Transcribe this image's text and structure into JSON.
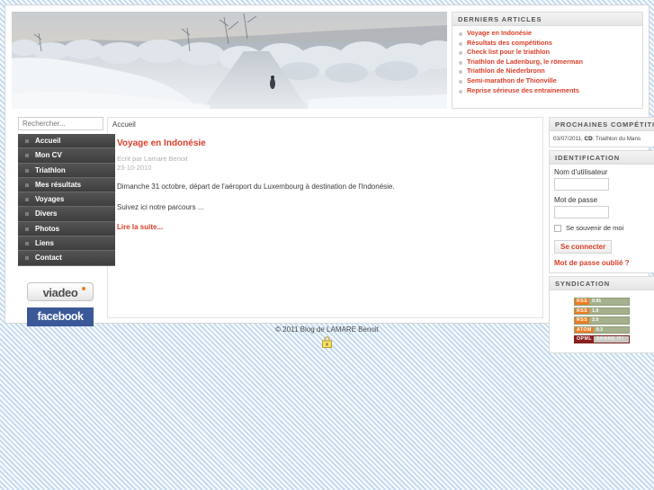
{
  "header": {
    "banner_alt": "snowy-winter-landscape-path"
  },
  "latest_articles": {
    "title": "DERNIERS ARTICLES",
    "items": [
      "Voyage en Indonésie",
      "Résultats des compétitions",
      "Check list pour le triathlon",
      "Triathlon de Ladenburg, le römerman",
      "Triathlon de Niederbronn",
      "Semi-marathon de Thionville",
      "Reprise sérieuse des entrainements"
    ]
  },
  "search": {
    "placeholder": "Rechercher..."
  },
  "breadcrumb": {
    "current": "Accueil"
  },
  "nav": {
    "items": [
      "Accueil",
      "Mon CV",
      "Triathlon",
      "Mes résultats",
      "Voyages",
      "Divers",
      "Photos",
      "Liens",
      "Contact"
    ]
  },
  "social": {
    "viadeo": "viadeo",
    "facebook": "facebook"
  },
  "article": {
    "title": "Voyage en Indonésie",
    "author_line": "Ecrit par Lamare Benoit",
    "date": "23-10-2010",
    "paragraph1": "Dimanche 31 octobre, départ de l'aéroport du Luxembourg à destination de l'Indonésie.",
    "paragraph2": "Suivez ici notre parcours ...",
    "read_more": "Lire la suite..."
  },
  "competitions": {
    "title": "PROCHAINES COMPÉTITIONS",
    "date": "03/07/2011, ",
    "category": "CD",
    "event": ": Triathlon du Mans"
  },
  "identification": {
    "title": "IDENTIFICATION",
    "username_label": "Nom d'utilisateur",
    "username_value": "",
    "password_label": "Mot de passe",
    "password_value": "",
    "remember_label": "Se souvenir de moi",
    "login_button": "Se connecter",
    "forgot_password": "Mot de passe oublié ?"
  },
  "syndication": {
    "title": "SYNDICATION",
    "feeds": [
      {
        "kind": "RSS",
        "version": "0.91"
      },
      {
        "kind": "RSS",
        "version": "1.0"
      },
      {
        "kind": "RSS",
        "version": "2.0"
      },
      {
        "kind": "ATOM",
        "version": "0.3"
      },
      {
        "kind": "OPML",
        "version": "SHARE IT!"
      }
    ]
  },
  "footer": {
    "copyright": "© 2011 Blog de LAMARE Benoit",
    "lock_icon": "padlock-icon"
  },
  "colors": {
    "accent_red": "#d9402b",
    "nav_dark": "#3e3e3e",
    "facebook_blue": "#3b5998",
    "rss_orange": "#ee7d22",
    "feed_green": "#a4b18c"
  }
}
